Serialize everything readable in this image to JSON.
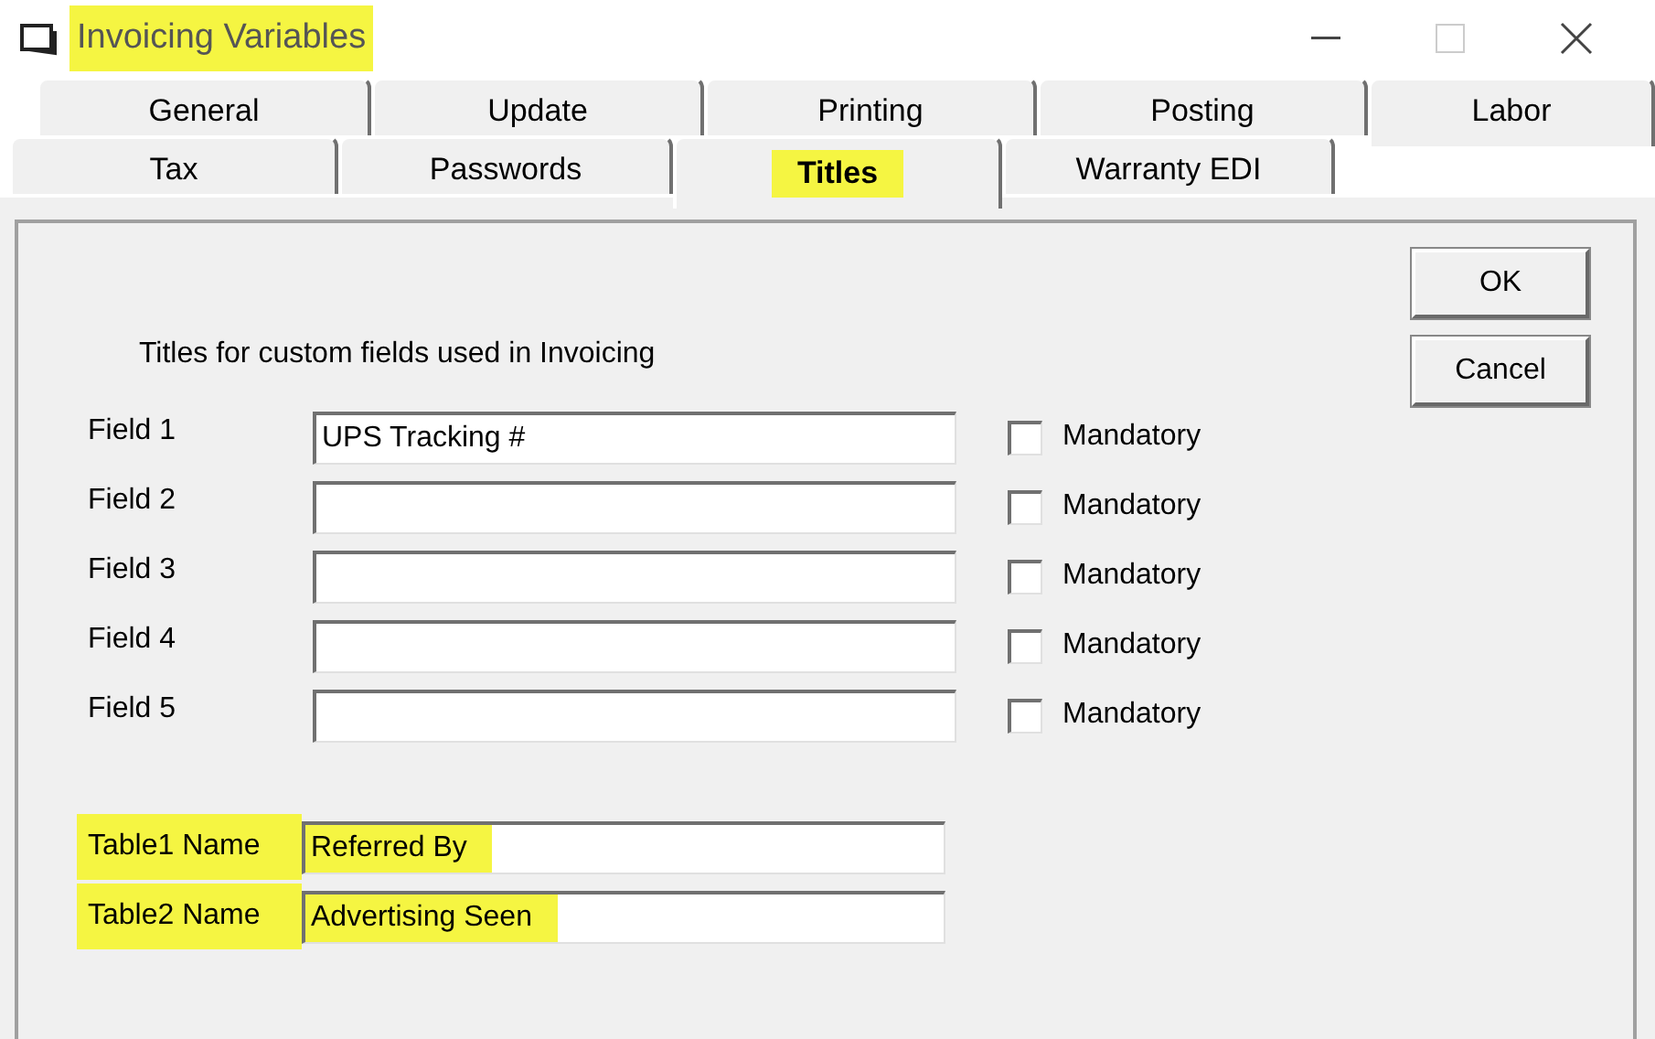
{
  "window": {
    "title": "Invoicing Variables",
    "highlighted": true
  },
  "tab_rows": [
    [
      {
        "label": "General",
        "selected": false,
        "highlighted": false
      },
      {
        "label": "Update",
        "selected": false,
        "highlighted": false
      },
      {
        "label": "Printing",
        "selected": false,
        "highlighted": false
      },
      {
        "label": "Posting",
        "selected": false,
        "highlighted": false
      },
      {
        "label": "Labor",
        "selected": false,
        "highlighted": false
      }
    ],
    [
      {
        "label": "Tax",
        "selected": false,
        "highlighted": false
      },
      {
        "label": "Passwords",
        "selected": false,
        "highlighted": false
      },
      {
        "label": "Titles",
        "selected": true,
        "highlighted": true
      },
      {
        "label": "Warranty EDI",
        "selected": false,
        "highlighted": false
      }
    ]
  ],
  "heading": "Titles for custom fields used in Invoicing",
  "fields": [
    {
      "label": "Field 1",
      "value": "UPS Tracking #",
      "checkbox_label": "Mandatory",
      "checked": false
    },
    {
      "label": "Field 2",
      "checkbox_label": "Mandatory",
      "checked": false
    },
    {
      "label": "Field 3",
      "checkbox_label": "Mandatory",
      "checked": false
    },
    {
      "label": "Field 4",
      "checkbox_label": "Mandatory",
      "checked": false
    },
    {
      "label": "Field 5",
      "checkbox_label": "Mandatory",
      "checked": false
    }
  ],
  "tables": [
    {
      "label": "Table1 Name",
      "value": "Referred By",
      "highlighted": true
    },
    {
      "label": "Table2 Name",
      "value": "Advertising Seen",
      "highlighted": true
    }
  ],
  "buttons": [
    "OK",
    "Cancel"
  ]
}
